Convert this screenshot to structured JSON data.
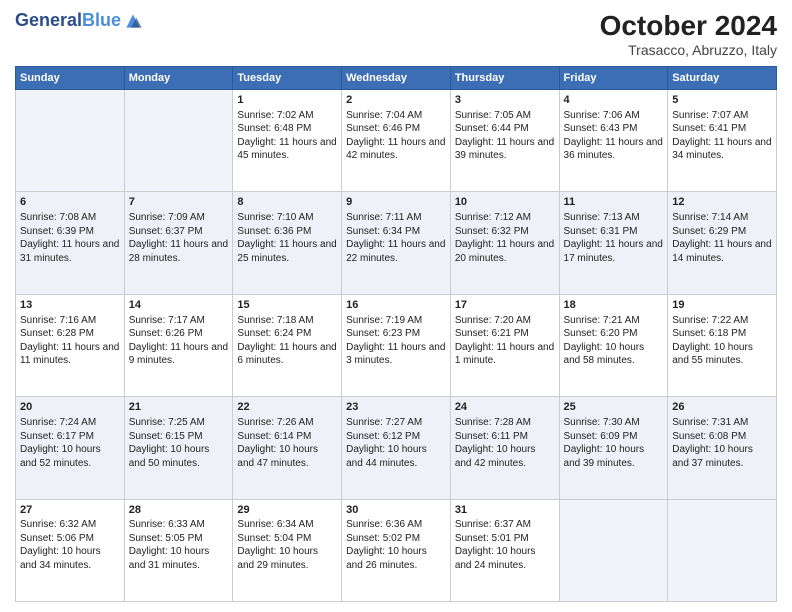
{
  "header": {
    "logo": {
      "general": "General",
      "blue": "Blue"
    },
    "title": "October 2024",
    "location": "Trasacco, Abruzzo, Italy"
  },
  "days_of_week": [
    "Sunday",
    "Monday",
    "Tuesday",
    "Wednesday",
    "Thursday",
    "Friday",
    "Saturday"
  ],
  "weeks": [
    [
      {
        "day": "",
        "sunrise": "",
        "sunset": "",
        "daylight": ""
      },
      {
        "day": "",
        "sunrise": "",
        "sunset": "",
        "daylight": ""
      },
      {
        "day": "1",
        "sunrise": "Sunrise: 7:02 AM",
        "sunset": "Sunset: 6:48 PM",
        "daylight": "Daylight: 11 hours and 45 minutes."
      },
      {
        "day": "2",
        "sunrise": "Sunrise: 7:04 AM",
        "sunset": "Sunset: 6:46 PM",
        "daylight": "Daylight: 11 hours and 42 minutes."
      },
      {
        "day": "3",
        "sunrise": "Sunrise: 7:05 AM",
        "sunset": "Sunset: 6:44 PM",
        "daylight": "Daylight: 11 hours and 39 minutes."
      },
      {
        "day": "4",
        "sunrise": "Sunrise: 7:06 AM",
        "sunset": "Sunset: 6:43 PM",
        "daylight": "Daylight: 11 hours and 36 minutes."
      },
      {
        "day": "5",
        "sunrise": "Sunrise: 7:07 AM",
        "sunset": "Sunset: 6:41 PM",
        "daylight": "Daylight: 11 hours and 34 minutes."
      }
    ],
    [
      {
        "day": "6",
        "sunrise": "Sunrise: 7:08 AM",
        "sunset": "Sunset: 6:39 PM",
        "daylight": "Daylight: 11 hours and 31 minutes."
      },
      {
        "day": "7",
        "sunrise": "Sunrise: 7:09 AM",
        "sunset": "Sunset: 6:37 PM",
        "daylight": "Daylight: 11 hours and 28 minutes."
      },
      {
        "day": "8",
        "sunrise": "Sunrise: 7:10 AM",
        "sunset": "Sunset: 6:36 PM",
        "daylight": "Daylight: 11 hours and 25 minutes."
      },
      {
        "day": "9",
        "sunrise": "Sunrise: 7:11 AM",
        "sunset": "Sunset: 6:34 PM",
        "daylight": "Daylight: 11 hours and 22 minutes."
      },
      {
        "day": "10",
        "sunrise": "Sunrise: 7:12 AM",
        "sunset": "Sunset: 6:32 PM",
        "daylight": "Daylight: 11 hours and 20 minutes."
      },
      {
        "day": "11",
        "sunrise": "Sunrise: 7:13 AM",
        "sunset": "Sunset: 6:31 PM",
        "daylight": "Daylight: 11 hours and 17 minutes."
      },
      {
        "day": "12",
        "sunrise": "Sunrise: 7:14 AM",
        "sunset": "Sunset: 6:29 PM",
        "daylight": "Daylight: 11 hours and 14 minutes."
      }
    ],
    [
      {
        "day": "13",
        "sunrise": "Sunrise: 7:16 AM",
        "sunset": "Sunset: 6:28 PM",
        "daylight": "Daylight: 11 hours and 11 minutes."
      },
      {
        "day": "14",
        "sunrise": "Sunrise: 7:17 AM",
        "sunset": "Sunset: 6:26 PM",
        "daylight": "Daylight: 11 hours and 9 minutes."
      },
      {
        "day": "15",
        "sunrise": "Sunrise: 7:18 AM",
        "sunset": "Sunset: 6:24 PM",
        "daylight": "Daylight: 11 hours and 6 minutes."
      },
      {
        "day": "16",
        "sunrise": "Sunrise: 7:19 AM",
        "sunset": "Sunset: 6:23 PM",
        "daylight": "Daylight: 11 hours and 3 minutes."
      },
      {
        "day": "17",
        "sunrise": "Sunrise: 7:20 AM",
        "sunset": "Sunset: 6:21 PM",
        "daylight": "Daylight: 11 hours and 1 minute."
      },
      {
        "day": "18",
        "sunrise": "Sunrise: 7:21 AM",
        "sunset": "Sunset: 6:20 PM",
        "daylight": "Daylight: 10 hours and 58 minutes."
      },
      {
        "day": "19",
        "sunrise": "Sunrise: 7:22 AM",
        "sunset": "Sunset: 6:18 PM",
        "daylight": "Daylight: 10 hours and 55 minutes."
      }
    ],
    [
      {
        "day": "20",
        "sunrise": "Sunrise: 7:24 AM",
        "sunset": "Sunset: 6:17 PM",
        "daylight": "Daylight: 10 hours and 52 minutes."
      },
      {
        "day": "21",
        "sunrise": "Sunrise: 7:25 AM",
        "sunset": "Sunset: 6:15 PM",
        "daylight": "Daylight: 10 hours and 50 minutes."
      },
      {
        "day": "22",
        "sunrise": "Sunrise: 7:26 AM",
        "sunset": "Sunset: 6:14 PM",
        "daylight": "Daylight: 10 hours and 47 minutes."
      },
      {
        "day": "23",
        "sunrise": "Sunrise: 7:27 AM",
        "sunset": "Sunset: 6:12 PM",
        "daylight": "Daylight: 10 hours and 44 minutes."
      },
      {
        "day": "24",
        "sunrise": "Sunrise: 7:28 AM",
        "sunset": "Sunset: 6:11 PM",
        "daylight": "Daylight: 10 hours and 42 minutes."
      },
      {
        "day": "25",
        "sunrise": "Sunrise: 7:30 AM",
        "sunset": "Sunset: 6:09 PM",
        "daylight": "Daylight: 10 hours and 39 minutes."
      },
      {
        "day": "26",
        "sunrise": "Sunrise: 7:31 AM",
        "sunset": "Sunset: 6:08 PM",
        "daylight": "Daylight: 10 hours and 37 minutes."
      }
    ],
    [
      {
        "day": "27",
        "sunrise": "Sunrise: 6:32 AM",
        "sunset": "Sunset: 5:06 PM",
        "daylight": "Daylight: 10 hours and 34 minutes."
      },
      {
        "day": "28",
        "sunrise": "Sunrise: 6:33 AM",
        "sunset": "Sunset: 5:05 PM",
        "daylight": "Daylight: 10 hours and 31 minutes."
      },
      {
        "day": "29",
        "sunrise": "Sunrise: 6:34 AM",
        "sunset": "Sunset: 5:04 PM",
        "daylight": "Daylight: 10 hours and 29 minutes."
      },
      {
        "day": "30",
        "sunrise": "Sunrise: 6:36 AM",
        "sunset": "Sunset: 5:02 PM",
        "daylight": "Daylight: 10 hours and 26 minutes."
      },
      {
        "day": "31",
        "sunrise": "Sunrise: 6:37 AM",
        "sunset": "Sunset: 5:01 PM",
        "daylight": "Daylight: 10 hours and 24 minutes."
      },
      {
        "day": "",
        "sunrise": "",
        "sunset": "",
        "daylight": ""
      },
      {
        "day": "",
        "sunrise": "",
        "sunset": "",
        "daylight": ""
      }
    ]
  ]
}
